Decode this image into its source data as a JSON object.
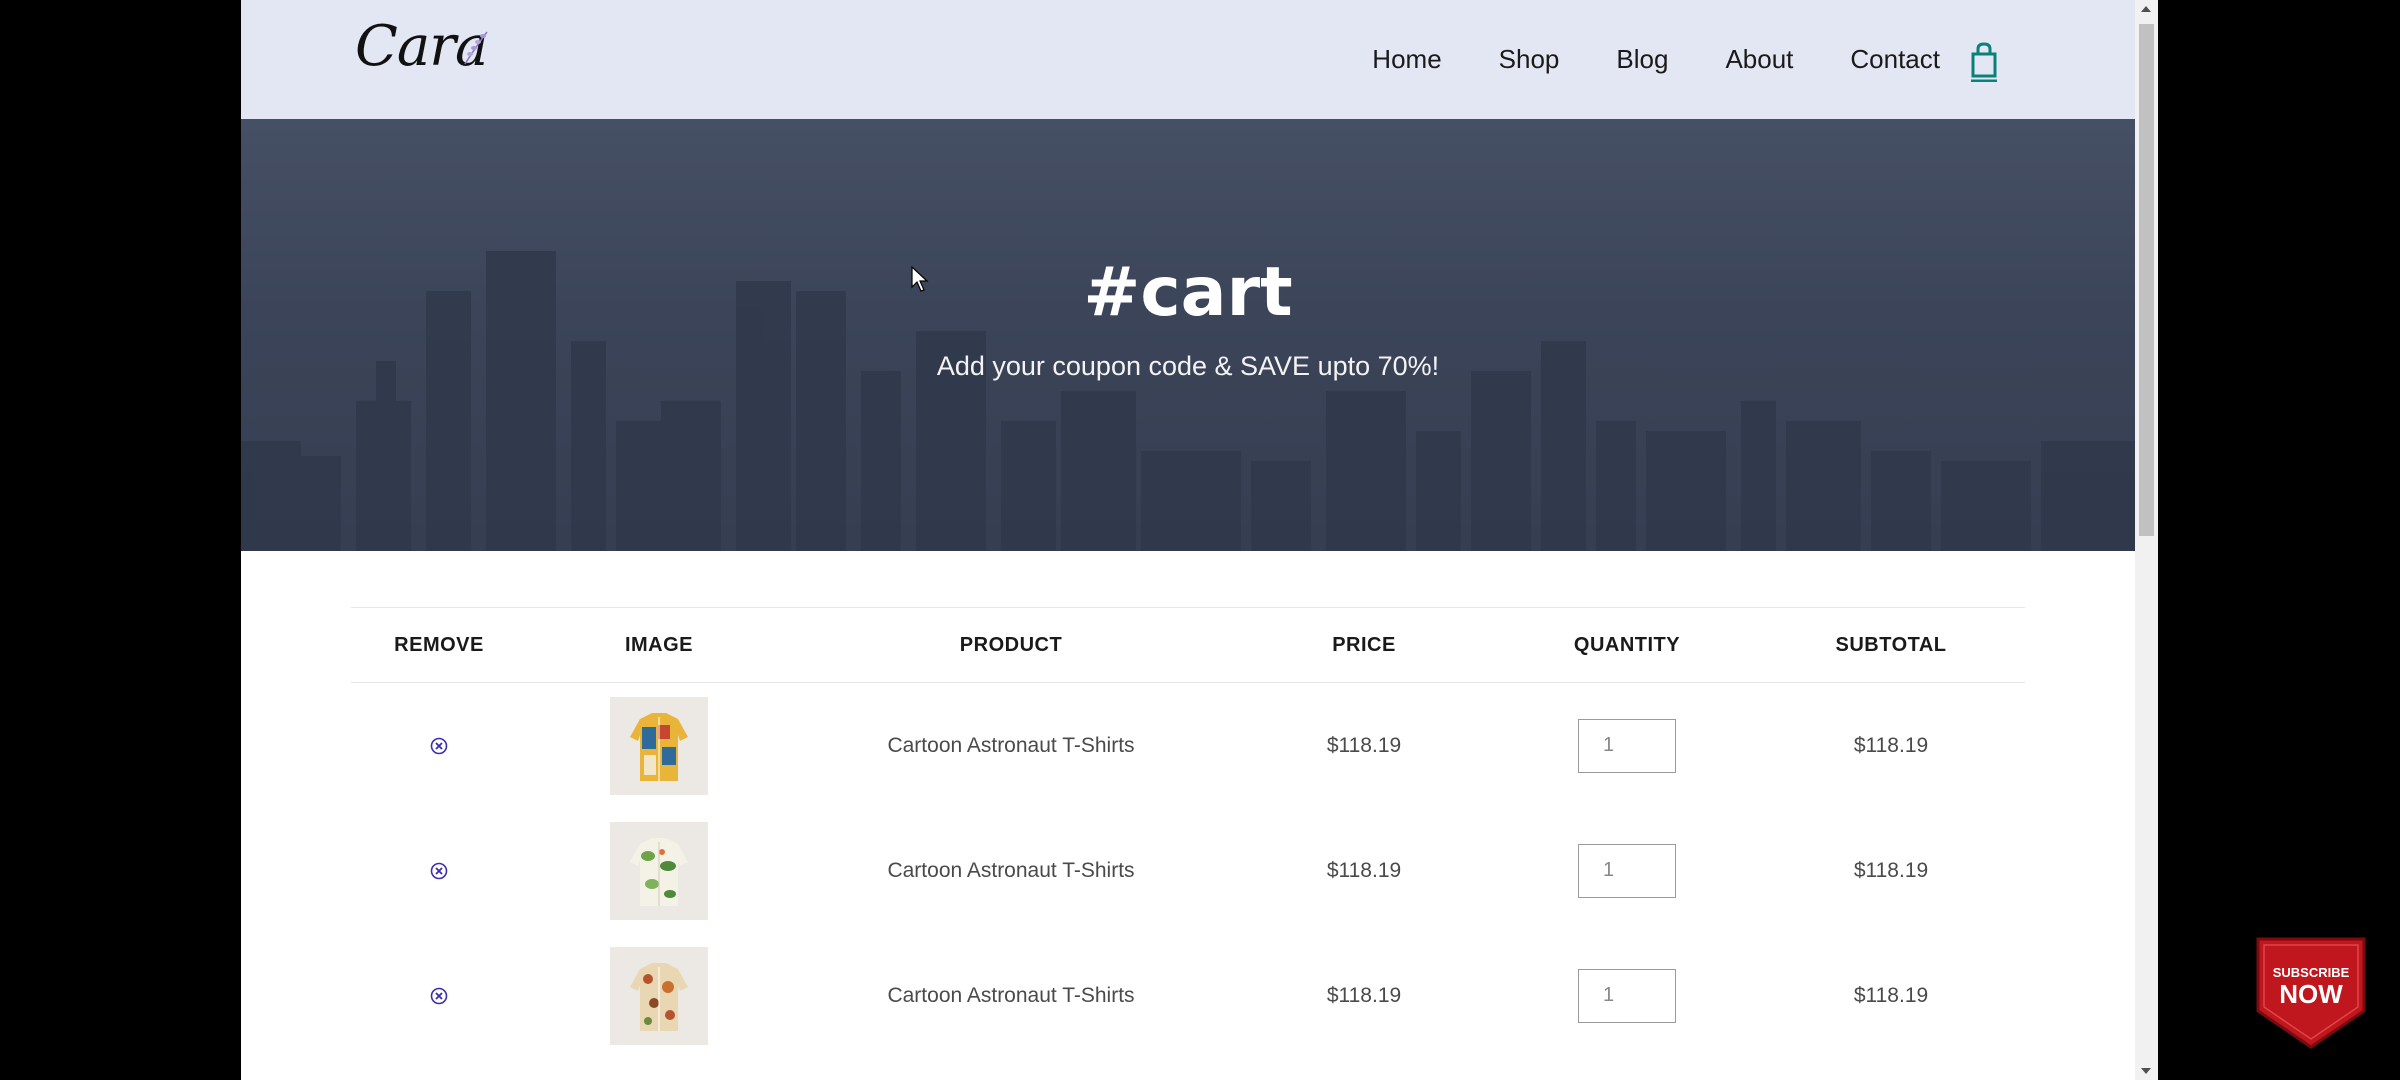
{
  "nav": {
    "logo_text": "Cara",
    "items": [
      "Home",
      "Shop",
      "Blog",
      "About",
      "Contact"
    ],
    "cart_icon": "shopping-bag-icon",
    "accent_color": "#088178"
  },
  "hero": {
    "title": "#cart",
    "subtitle": "Add your coupon code & SAVE upto 70%!"
  },
  "table": {
    "headers": [
      "REMOVE",
      "IMAGE",
      "PRODUCT",
      "PRICE",
      "QUANTITY",
      "SUBTOTAL"
    ],
    "rows": [
      {
        "remove_icon": "remove-circle-icon",
        "image": "shirt-blue-yellow",
        "product": "Cartoon Astronaut T-Shirts",
        "price": "$118.19",
        "quantity": "1",
        "subtotal": "$118.19"
      },
      {
        "remove_icon": "remove-circle-icon",
        "image": "shirt-white-floral",
        "product": "Cartoon Astronaut T-Shirts",
        "price": "$118.19",
        "quantity": "1",
        "subtotal": "$118.19"
      },
      {
        "remove_icon": "remove-circle-icon",
        "image": "shirt-beige-floral",
        "product": "Cartoon Astronaut T-Shirts",
        "price": "$118.19",
        "quantity": "1",
        "subtotal": "$118.19"
      }
    ]
  },
  "overlay": {
    "subscribe_line1": "SUBSCRIBE",
    "subscribe_line2": "NOW",
    "subscribe_color": "#c0161d"
  }
}
